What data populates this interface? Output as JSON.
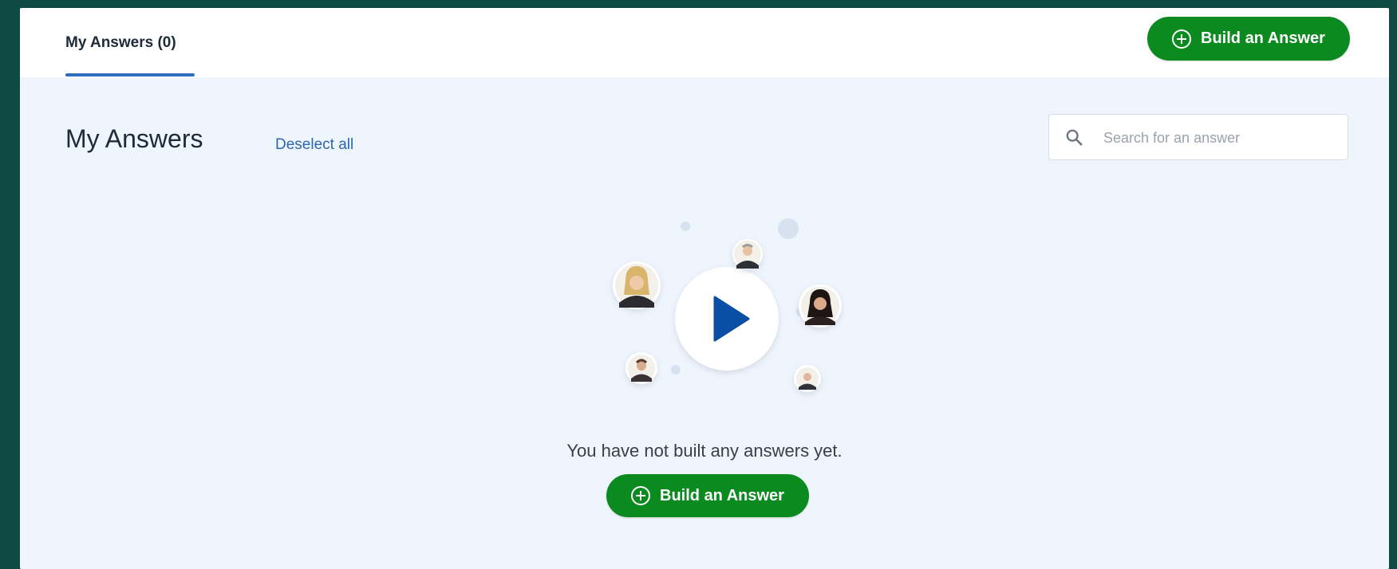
{
  "tabs": [
    {
      "label": "My Answers (0)",
      "active": true
    }
  ],
  "header": {
    "build_button_label": "Build an Answer"
  },
  "main": {
    "title": "My Answers",
    "deselect_label": "Deselect all",
    "search": {
      "placeholder": "Search for an answer",
      "value": ""
    },
    "empty_state": {
      "message": "You have not built any answers yet.",
      "build_button_label": "Build an Answer"
    }
  },
  "colors": {
    "accent_green": "#0b8a1f",
    "link_blue": "#2d66b5",
    "play_blue": "#0a4fa6",
    "tab_underline": "#2f6fbf",
    "background": "#eff5fc"
  },
  "icons": {
    "button_icon": "plus-circle-icon",
    "search_icon": "search-icon",
    "empty_state_icon": "play-icon"
  }
}
